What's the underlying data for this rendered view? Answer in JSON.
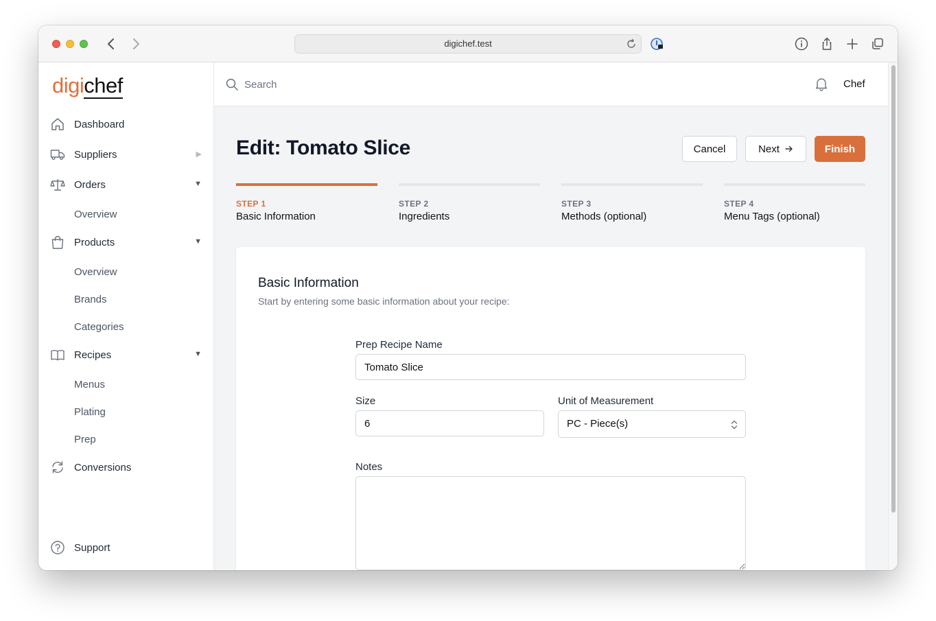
{
  "browser": {
    "url": "digichef.test"
  },
  "logo": {
    "part1": "digi",
    "part2": "chef"
  },
  "sidebar": {
    "items": [
      {
        "label": "Dashboard"
      },
      {
        "label": "Suppliers"
      },
      {
        "label": "Orders"
      },
      {
        "label": "Products"
      },
      {
        "label": "Recipes"
      },
      {
        "label": "Conversions"
      }
    ],
    "orders_sub": [
      "Overview"
    ],
    "products_sub": [
      "Overview",
      "Brands",
      "Categories"
    ],
    "recipes_sub": [
      "Menus",
      "Plating",
      "Prep"
    ],
    "support_label": "Support"
  },
  "topbar": {
    "search_placeholder": "Search",
    "user_name": "Chef"
  },
  "page": {
    "title": "Edit: Tomato Slice",
    "cancel_label": "Cancel",
    "next_label": "Next",
    "finish_label": "Finish"
  },
  "steps": [
    {
      "num": "STEP 1",
      "name": "Basic Information",
      "active": true
    },
    {
      "num": "STEP 2",
      "name": "Ingredients",
      "active": false
    },
    {
      "num": "STEP 3",
      "name": "Methods (optional)",
      "active": false
    },
    {
      "num": "STEP 4",
      "name": "Menu Tags (optional)",
      "active": false
    }
  ],
  "form": {
    "title": "Basic Information",
    "subtitle": "Start by entering some basic information about your recipe:",
    "name_label": "Prep Recipe Name",
    "name_value": "Tomato Slice",
    "size_label": "Size",
    "size_value": "6",
    "uom_label": "Unit of Measurement",
    "uom_value": "PC - Piece(s)",
    "notes_label": "Notes",
    "notes_value": ""
  },
  "colors": {
    "accent": "#d9703c",
    "logo_accent": "#e0703a"
  }
}
